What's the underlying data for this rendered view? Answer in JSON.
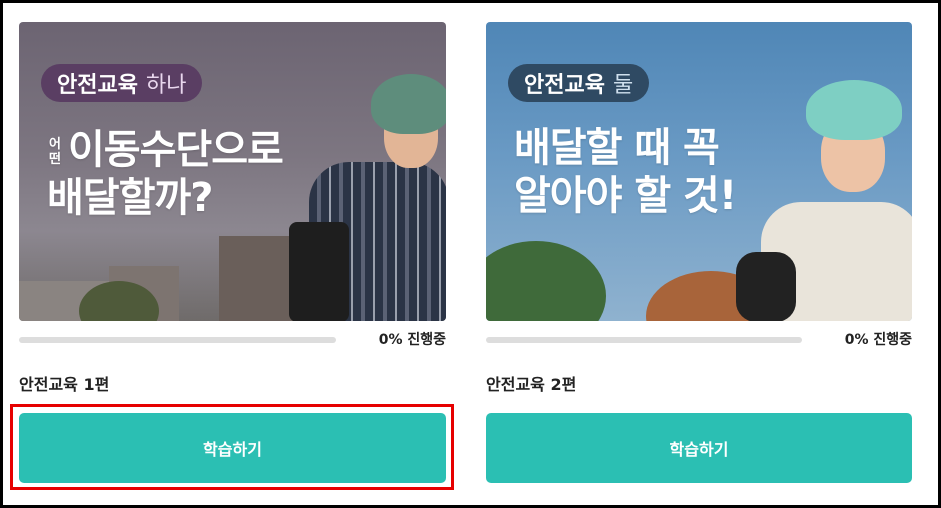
{
  "courses": [
    {
      "badge_main": "안전교육",
      "badge_sub": "하나",
      "headline_small": "어떤",
      "headline_line1": "이동수단으로",
      "headline_line2": "배달할까?",
      "progress_percent": 0,
      "progress_text": "0% 진행중",
      "title": "안전교육 1편",
      "button_label": "학습하기"
    },
    {
      "badge_main": "안전교육",
      "badge_sub": "둘",
      "headline_line1": "배달할 때 꼭",
      "headline_line2": "알아야 할 것!",
      "progress_percent": 0,
      "progress_text": "0% 진행중",
      "title": "안전교육 2편",
      "button_label": "학습하기"
    }
  ],
  "colors": {
    "accent": "#2bbfb3",
    "highlight": "#e60000"
  }
}
